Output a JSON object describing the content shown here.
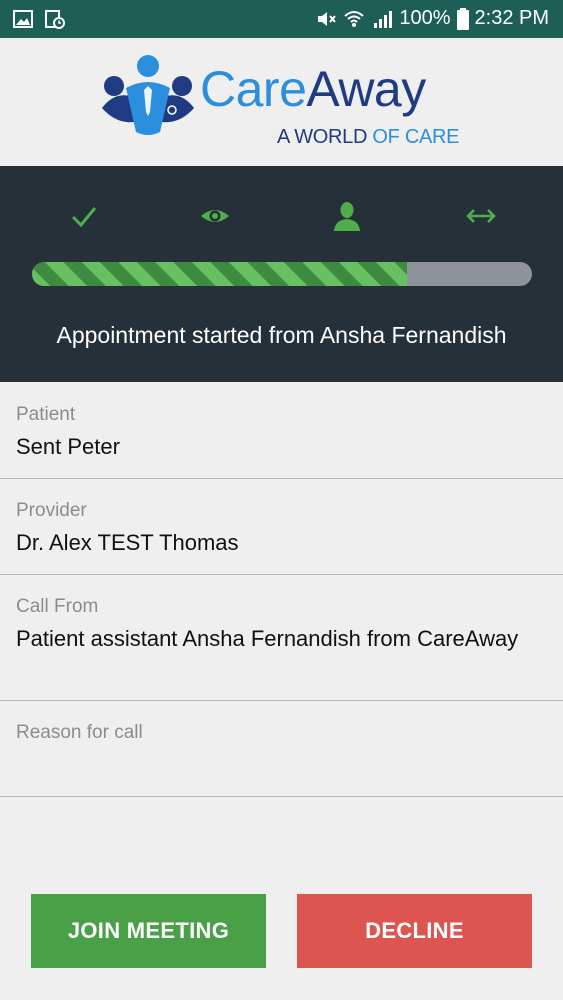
{
  "status_bar": {
    "battery": "100%",
    "time": "2:32 PM",
    "icons": [
      "image-icon",
      "calendar-clock-icon",
      "mute-icon",
      "wifi-icon",
      "signal-icon",
      "battery-icon"
    ]
  },
  "brand": {
    "name_part1": "Care",
    "name_part2": "Away",
    "tagline_part1": "A WORLD ",
    "tagline_part2": "OF CARE",
    "colors": {
      "light_blue": "#2b8fde",
      "dark_blue": "#1f3b82"
    }
  },
  "progress": {
    "steps": [
      "check-icon",
      "eye-icon",
      "user-icon",
      "arrows-horizontal-icon"
    ],
    "fraction_complete": 0.75,
    "message": "Appointment started from Ansha Fernandish",
    "colors": {
      "panel": "#263038",
      "green": "#67c062",
      "track": "#8d9399"
    }
  },
  "fields": [
    {
      "label": "Patient",
      "value": "Sent Peter"
    },
    {
      "label": "Provider",
      "value": "Dr. Alex TEST Thomas"
    },
    {
      "label": "Call From",
      "value": "Patient assistant Ansha Fernandish from CareAway"
    },
    {
      "label": "Reason for call",
      "value": ""
    }
  ],
  "actions": {
    "join_label": "JOIN MEETING",
    "decline_label": "DECLINE",
    "colors": {
      "join": "#49a046",
      "decline": "#dc5550"
    }
  }
}
